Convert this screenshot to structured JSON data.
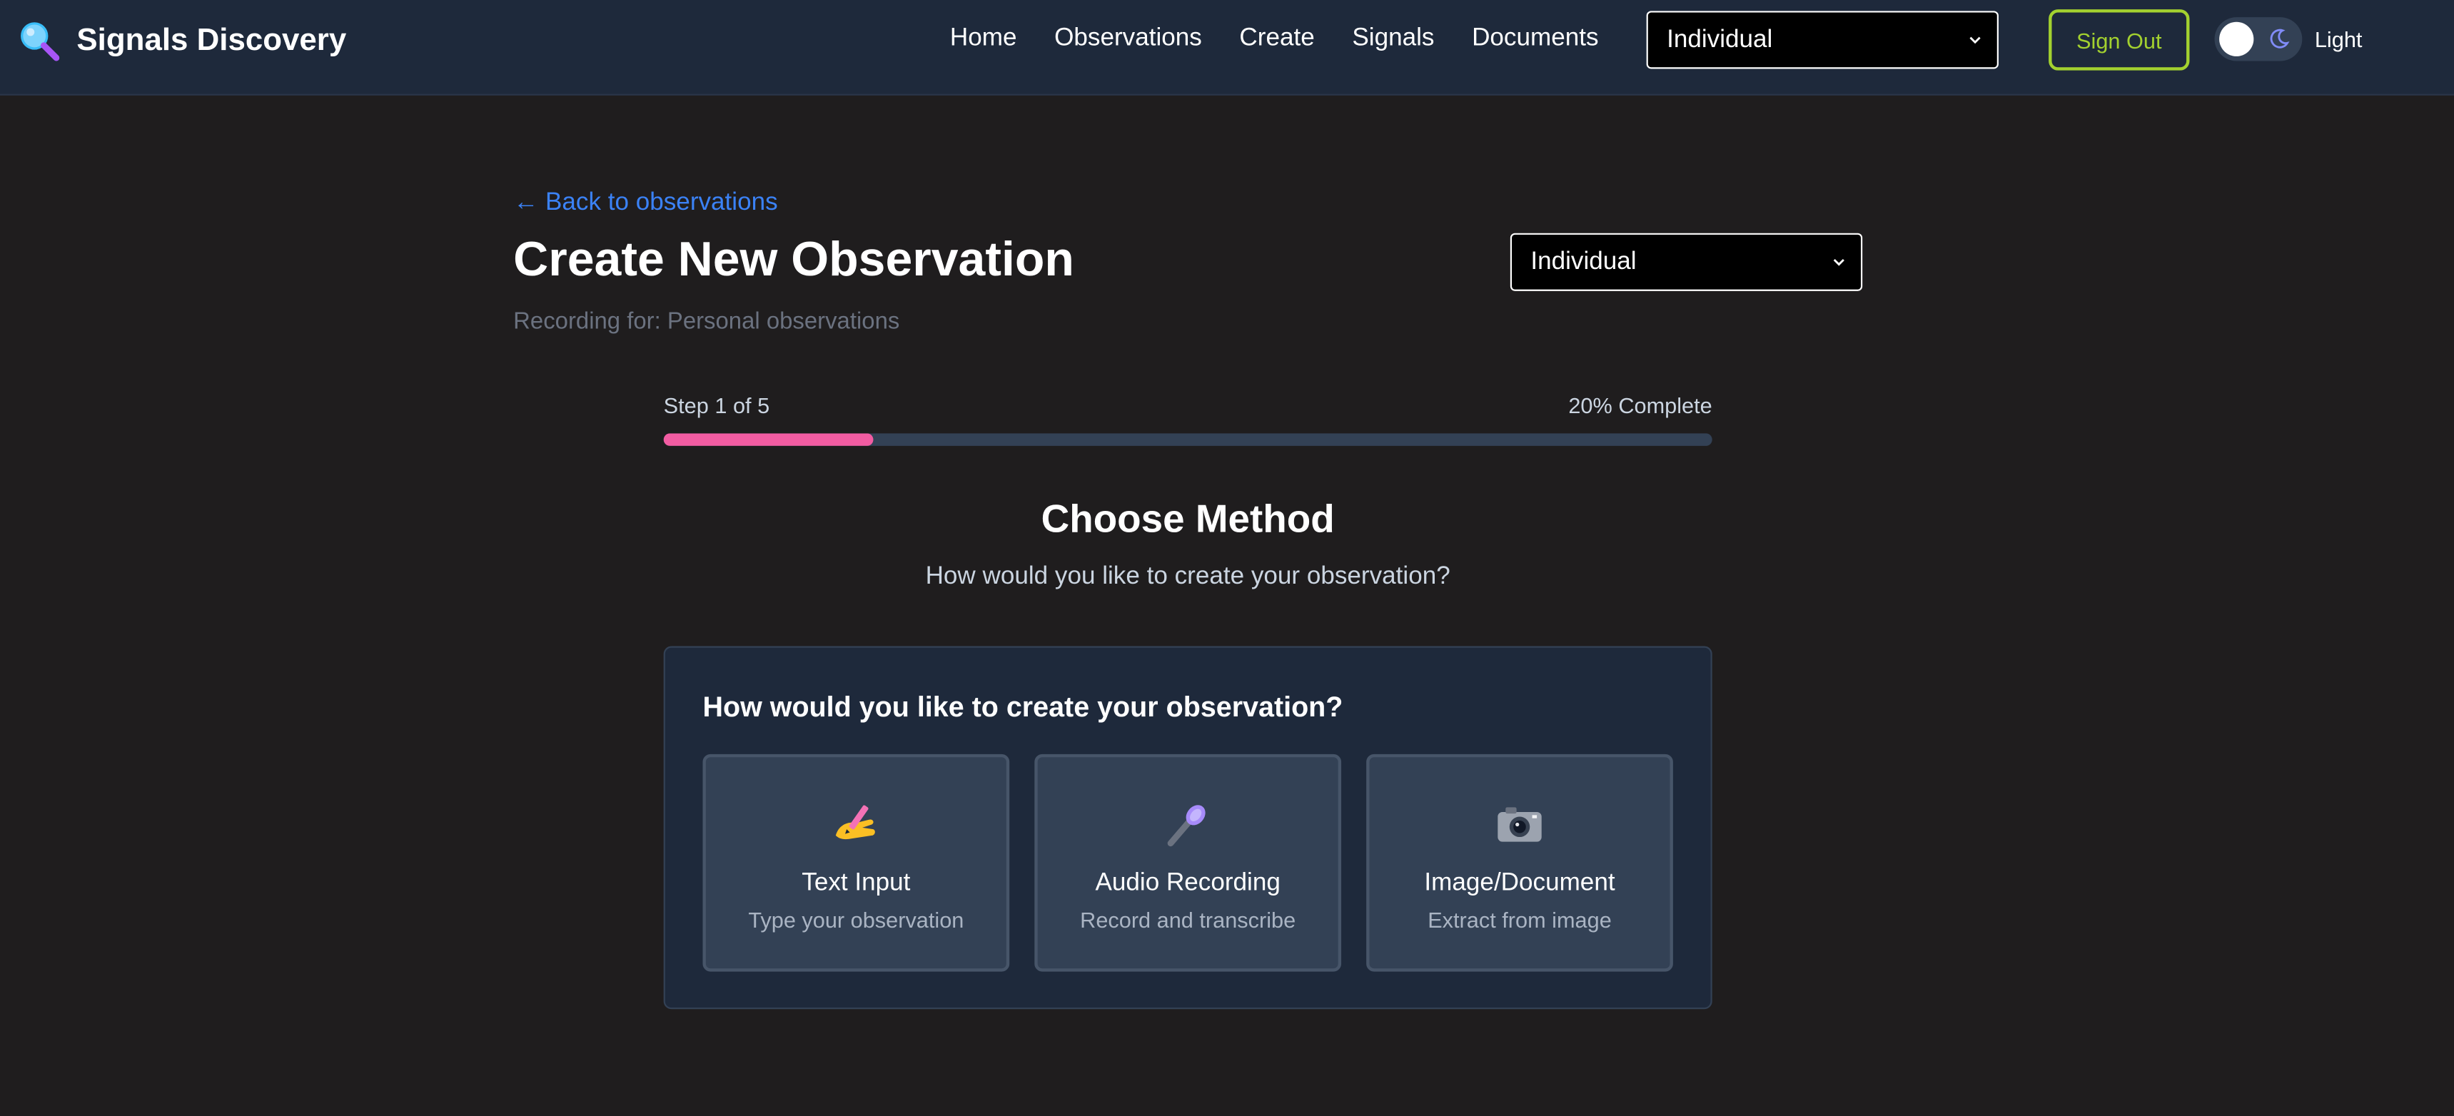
{
  "app": {
    "title": "Signals Discovery",
    "icon": "magnifier-icon"
  },
  "nav": {
    "links": [
      "Home",
      "Observations",
      "Create",
      "Signals",
      "Documents"
    ],
    "context_select": "Individual",
    "sign_out": "Sign Out",
    "theme_label": "Light",
    "theme_icon": "moon-icon"
  },
  "header": {
    "back_link": "← Back to observations",
    "title": "Create New Observation",
    "recording_for": "Recording for: Personal observations",
    "context_select": "Individual"
  },
  "progress": {
    "step_label": "Step 1 of 5",
    "percent_label": "20% Complete",
    "percent": 20
  },
  "method": {
    "title": "Choose Method",
    "subtitle": "How would you like to create your observation?",
    "card_title": "How would you like to create your observation?",
    "options": [
      {
        "icon": "writing-hand-icon",
        "label": "Text Input",
        "description": "Type your observation"
      },
      {
        "icon": "microphone-icon",
        "label": "Audio Recording",
        "description": "Record and transcribe"
      },
      {
        "icon": "camera-icon",
        "label": "Image/Document",
        "description": "Extract from image"
      }
    ]
  },
  "colors": {
    "navbar_bg": "#1e293b",
    "page_bg": "#1f1d1e",
    "link_blue": "#3b82f6",
    "signout_green": "#a3d12f",
    "progress_pink": "#f25ca2"
  }
}
